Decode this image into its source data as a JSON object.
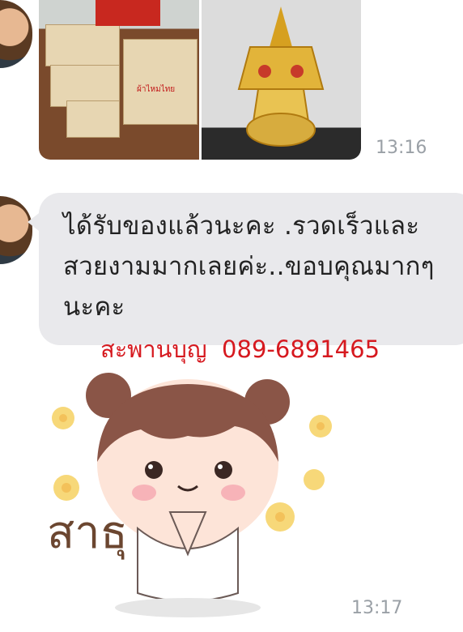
{
  "chat": {
    "messages": [
      {
        "type": "photos",
        "time": "13:16"
      },
      {
        "type": "text",
        "text": "ได้รับของแล้วนะคะ .รวดเร็วและสวยงามมากเลยค่ะ..ขอบคุณมากๆ นะคะ"
      },
      {
        "type": "sticker",
        "sticker_text": "สาธุ",
        "time": "13:17"
      }
    ],
    "overlay": "สะพานบุญ  089-6891465"
  },
  "photo_box_text": {
    "brand": "ผ้าไหมไทย"
  },
  "colors": {
    "overlay_red": "#d6191f",
    "bubble_bg": "#e9e9ec",
    "timestamp": "#9aa0a6"
  }
}
